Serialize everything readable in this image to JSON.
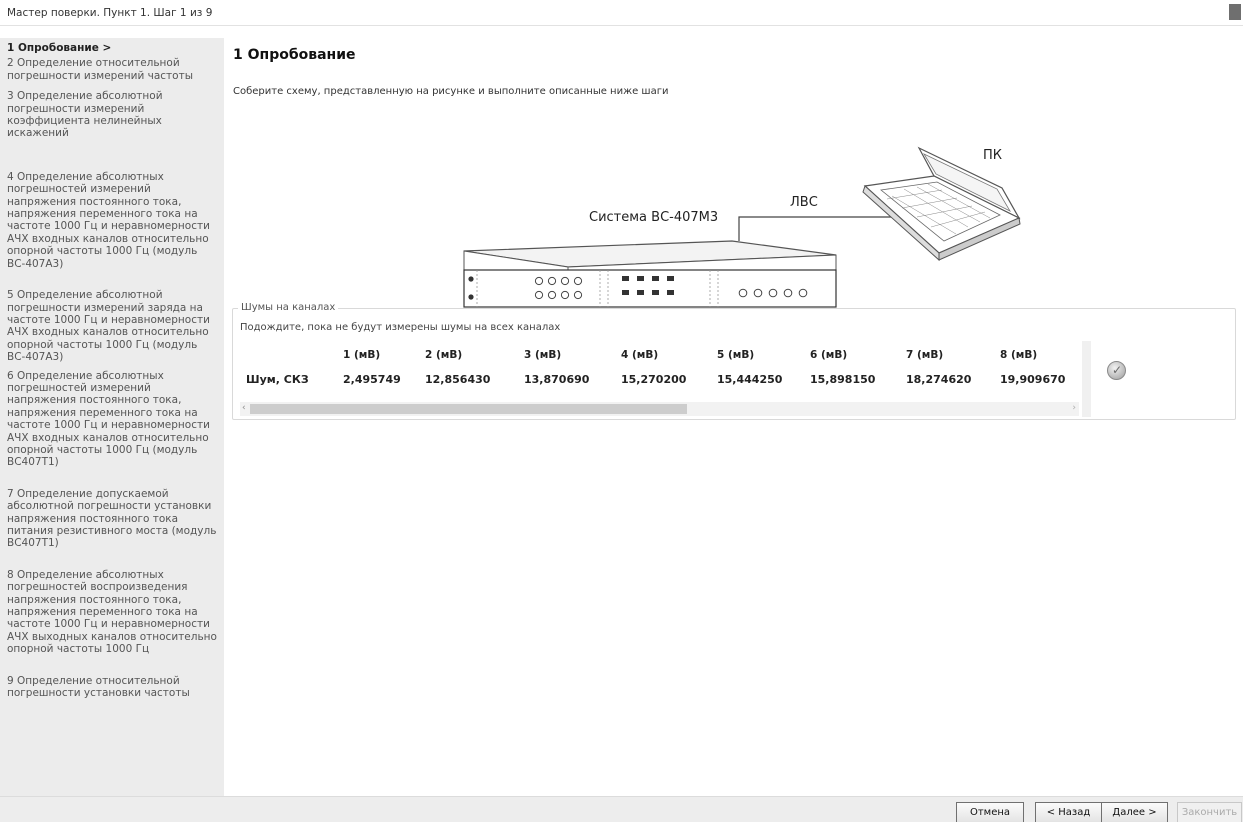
{
  "window": {
    "title": "Мастер поверки. Пункт 1. Шаг 1 из 9"
  },
  "sidebar": {
    "items": [
      {
        "label": "1 Опробование >",
        "current": true
      },
      {
        "label": "2 Определение относительной погрешности измерений частоты",
        "current": false
      },
      {
        "label": "3 Определение абсолютной погрешности измерений коэффициента нелинейных искажений",
        "current": false
      },
      {
        "label": "4 Определение абсолютных погрешностей измерений напряжения постоянного тока, напряжения переменного тока на частоте 1000 Гц и неравномерности АЧХ входных каналов относительно опорной частоты 1000 Гц (модуль ВС-407А3)",
        "current": false
      },
      {
        "label": "5 Определение абсолютной погрешности измерений заряда на частоте 1000 Гц и неравномерности АЧХ входных каналов относительно опорной частоты 1000 Гц (модуль ВС-407А3)",
        "current": false
      },
      {
        "label": "6 Определение абсолютных погрешностей измерений напряжения постоянного тока, напряжения переменного тока на частоте 1000 Гц и неравномерности АЧХ входных каналов относительно опорной частоты 1000 Гц (модуль ВС407Т1)",
        "current": false
      },
      {
        "label": "7 Определение допускаемой абсолютной погрешности установки напряжения постоянного тока питания резистивного моста (модуль ВС407Т1)",
        "current": false
      },
      {
        "label": "8 Определение абсолютных погрешностей воспроизведения напряжения постоянного тока, напряжения переменного тока на частоте 1000 Гц и неравномерности АЧХ выходных каналов относительно опорной частоты 1000 Гц",
        "current": false
      },
      {
        "label": "9 Определение относительной погрешности установки частоты",
        "current": false
      }
    ]
  },
  "main": {
    "heading": "1 Опробование",
    "instruction": "Соберите схему, представленную на рисунке и выполните описанные ниже шаги",
    "diagram": {
      "system_label": "Система ВС-407М3",
      "network_label": "ЛВС",
      "pc_label": "ПК"
    },
    "noise": {
      "group_title": "Шумы на каналах",
      "message": "Подождите, пока не будут измерены шумы на всех каналах",
      "row_label": "Шум, СКЗ",
      "channels": [
        {
          "header": "1 (мВ)",
          "value": "2,495749"
        },
        {
          "header": "2 (мВ)",
          "value": "12,856430"
        },
        {
          "header": "3 (мВ)",
          "value": "13,870690"
        },
        {
          "header": "4 (мВ)",
          "value": "15,270200"
        },
        {
          "header": "5 (мВ)",
          "value": "15,444250"
        },
        {
          "header": "6 (мВ)",
          "value": "15,898150"
        },
        {
          "header": "7 (мВ)",
          "value": "18,274620"
        },
        {
          "header": "8 (мВ)",
          "value": "19,909670"
        }
      ],
      "status_icon": "check-circle-icon"
    }
  },
  "footer": {
    "cancel_label": "Отмена",
    "back_label": "< Назад",
    "next_label": "Далее >",
    "finish_label": "Закончить"
  }
}
